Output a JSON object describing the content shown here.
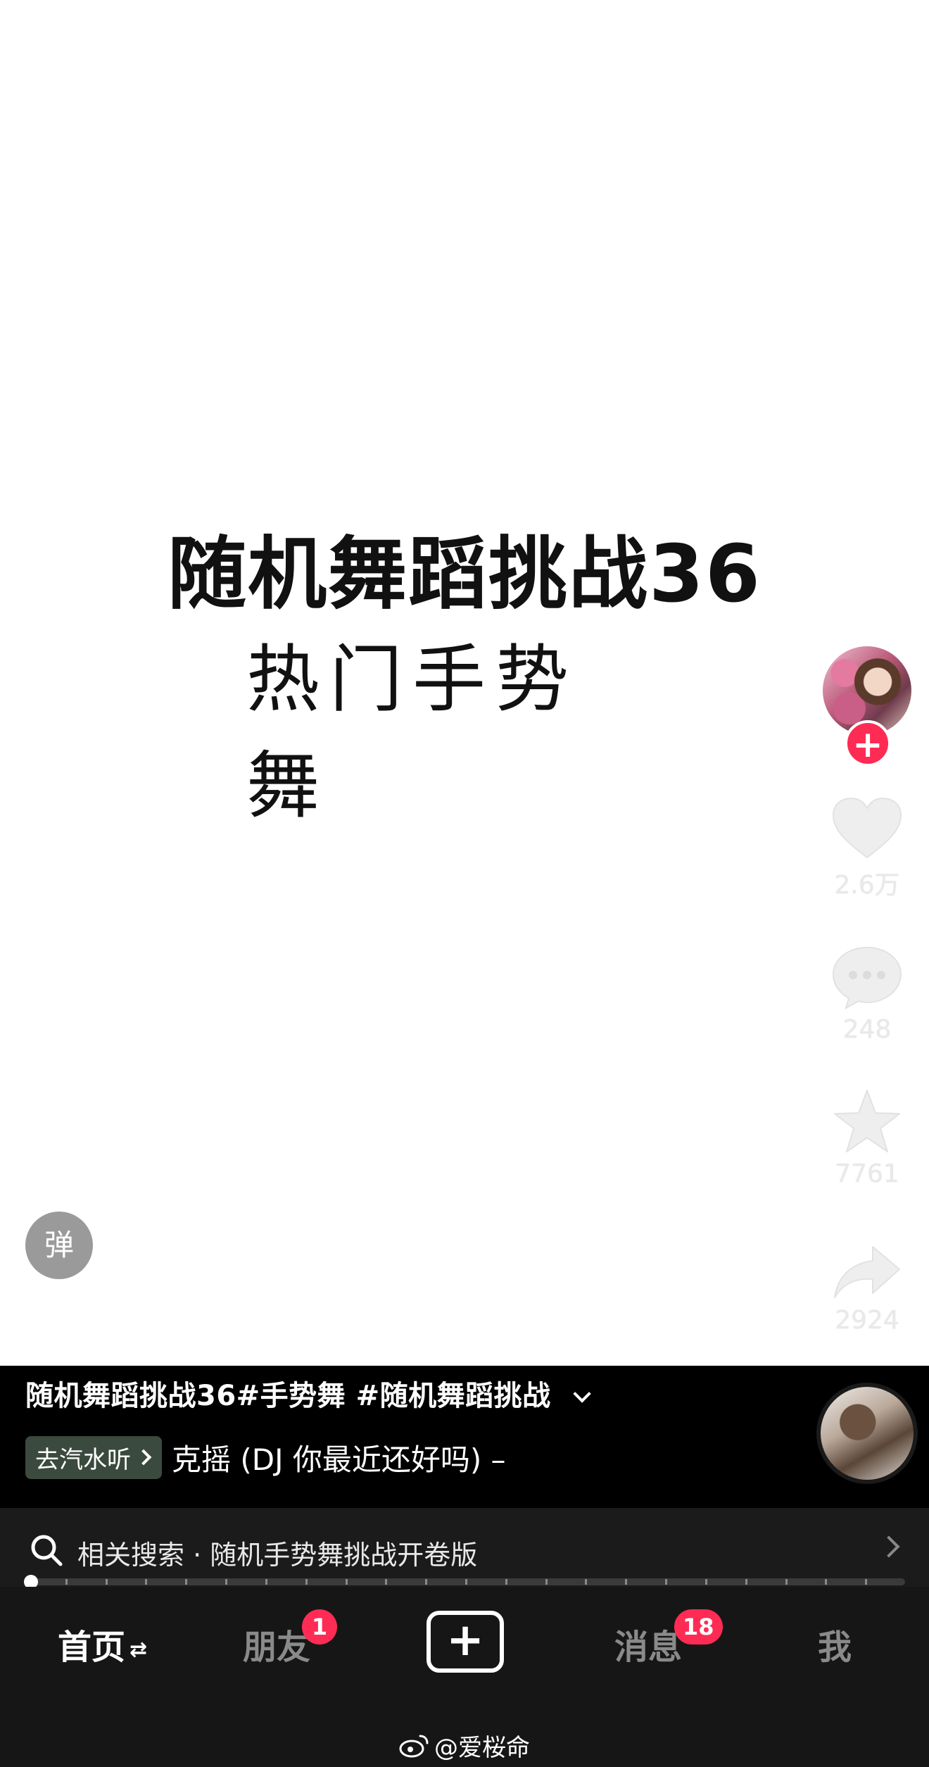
{
  "video": {
    "title": "随机舞蹈挑战36",
    "subtitle": "热门手势舞"
  },
  "sidebar": {
    "like_count": "2.6万",
    "comment_count": "248",
    "favorite_count": "7761",
    "share_count": "2924",
    "follow_symbol": "+"
  },
  "danmaku": {
    "label": "弹"
  },
  "info": {
    "caption": "随机舞蹈挑战36#手势舞 #随机舞蹈挑战",
    "music_chip": "去汽水听",
    "music_title": "克摇 (DJ 你最近还好吗) –"
  },
  "search": {
    "text": "相关搜索 · 随机手势舞挑战开卷版"
  },
  "progress": {
    "fraction": 0.0
  },
  "tabs": {
    "home": "首页",
    "home_suffix": "⇄",
    "friends": "朋友",
    "friends_badge": "1",
    "create_symbol": "+",
    "messages": "消息",
    "messages_badge": "18",
    "me": "我"
  },
  "watermark": {
    "text": "@爱桜命"
  },
  "colors": {
    "accent": "#fe2c55",
    "panel": "#000000",
    "tab_bar": "#161616"
  }
}
